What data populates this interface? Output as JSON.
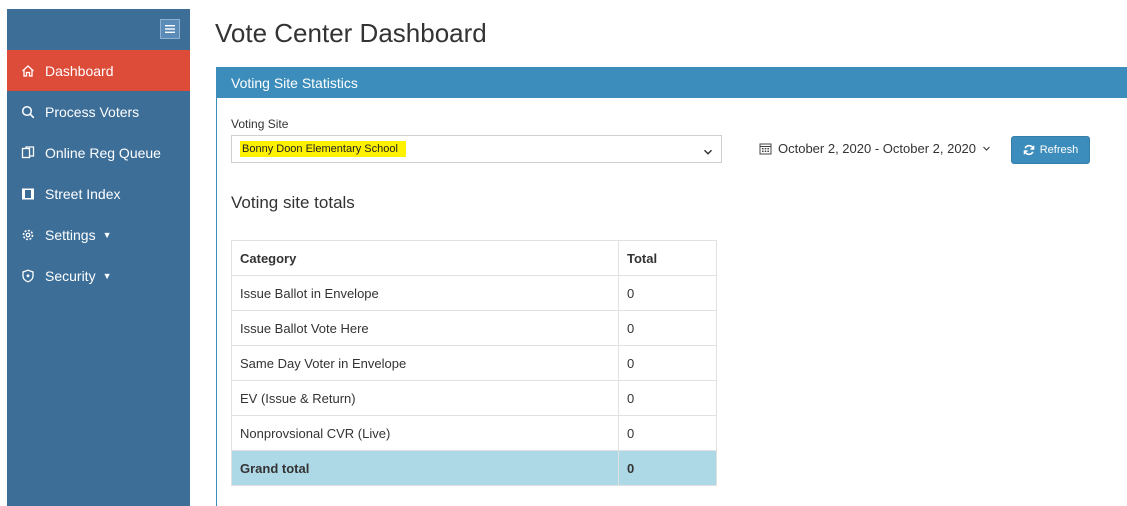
{
  "page": {
    "title": "Vote Center Dashboard"
  },
  "sidebar": {
    "items": [
      {
        "label": "Dashboard",
        "icon": "home-icon",
        "active": true
      },
      {
        "label": "Process Voters",
        "icon": "search-icon"
      },
      {
        "label": "Online Reg Queue",
        "icon": "copy-icon"
      },
      {
        "label": "Street Index",
        "icon": "columns-icon"
      },
      {
        "label": "Settings",
        "icon": "gear-icon",
        "has_caret": true
      },
      {
        "label": "Security",
        "icon": "shield-icon",
        "has_caret": true
      }
    ]
  },
  "panel": {
    "header": "Voting Site Statistics"
  },
  "voting_site": {
    "label": "Voting Site",
    "selected": "Bonny Doon Elementary School",
    "highlight_color": "#fff200"
  },
  "date_range": {
    "value": "October 2, 2020 - October 2, 2020"
  },
  "refresh": {
    "label": "Refresh"
  },
  "totals": {
    "title": "Voting site totals",
    "columns": [
      "Category",
      "Total"
    ],
    "rows": [
      {
        "category": "Issue Ballot in Envelope",
        "total": "0"
      },
      {
        "category": "Issue Ballot Vote Here",
        "total": "0"
      },
      {
        "category": "Same Day Voter in Envelope",
        "total": "0"
      },
      {
        "category": "EV (Issue & Return)",
        "total": "0"
      },
      {
        "category": "Nonprovsional CVR (Live)",
        "total": "0"
      }
    ],
    "grand_total": {
      "category": "Grand total",
      "total": "0"
    }
  },
  "colors": {
    "sidebar_bg": "#3c6e98",
    "active_item": "#dd4b39",
    "panel_header": "#3c8dbc",
    "grand_total_row": "#add8e6"
  }
}
